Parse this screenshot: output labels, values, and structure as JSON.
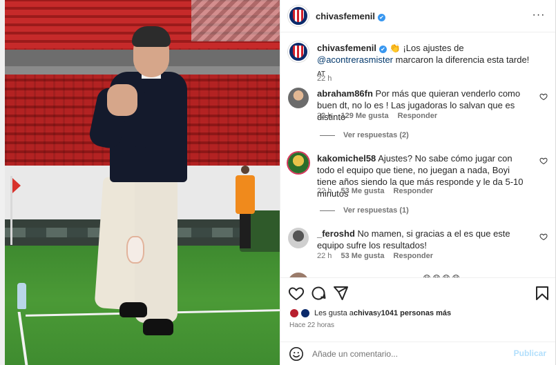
{
  "post": {
    "username": "chivasfemenil",
    "verified_mark": "✔",
    "more_label": "···"
  },
  "caption": {
    "username": "chivasfemenil",
    "emoji": "👏",
    "text_before": "¡Los ajustes de ",
    "mention": "@acontrerasmister",
    "text_after": " marcaron la diferencia esta tarde!",
    "suffix": " AT",
    "time": "22 h"
  },
  "comments": [
    {
      "username": "abraham86fn",
      "text": "Por más que quieran venderlo como buen dt, no lo es ! Las jugadoras lo salvan que es distinto",
      "time": "22 h",
      "likes": "129 Me gusta",
      "reply": "Responder",
      "view_replies": "Ver respuestas (2)"
    },
    {
      "username": "kakomichel58",
      "text": "Ajustes? No sabe cómo jugar con todo el equipo que tiene, no juegan a nada, Boyi tiene años siendo la que más responde y le da 5-10 minutos",
      "time": "22 h",
      "likes": "53 Me gusta",
      "reply": "Responder",
      "view_replies": "Ver respuestas (1)"
    },
    {
      "username": "_feroshd",
      "text": "No mamen, si gracias a el es que este equipo sufre los resultados!",
      "time": "22 h",
      "likes": "53 Me gusta",
      "reply": "Responder"
    }
  ],
  "partial_comment": {
    "emoji_tail": "😂😂😂😂"
  },
  "actions": {
    "icons": [
      "heart-icon",
      "comment-icon",
      "share-icon",
      "bookmark-icon"
    ],
    "likes_prefix": "Les gusta a ",
    "likes_user": "chivas",
    "likes_middle": " y ",
    "likes_count": "1041 personas más",
    "time_ago": "Hace 22 horas"
  },
  "comment_box": {
    "placeholder": "Añade un comentario...",
    "post_label": "Publicar"
  },
  "colors": {
    "brand_blue": "#0b2a6b",
    "brand_red": "#d11f2a",
    "link": "#00376b",
    "muted": "#737373",
    "publish_disabled": "#b2dffc"
  }
}
